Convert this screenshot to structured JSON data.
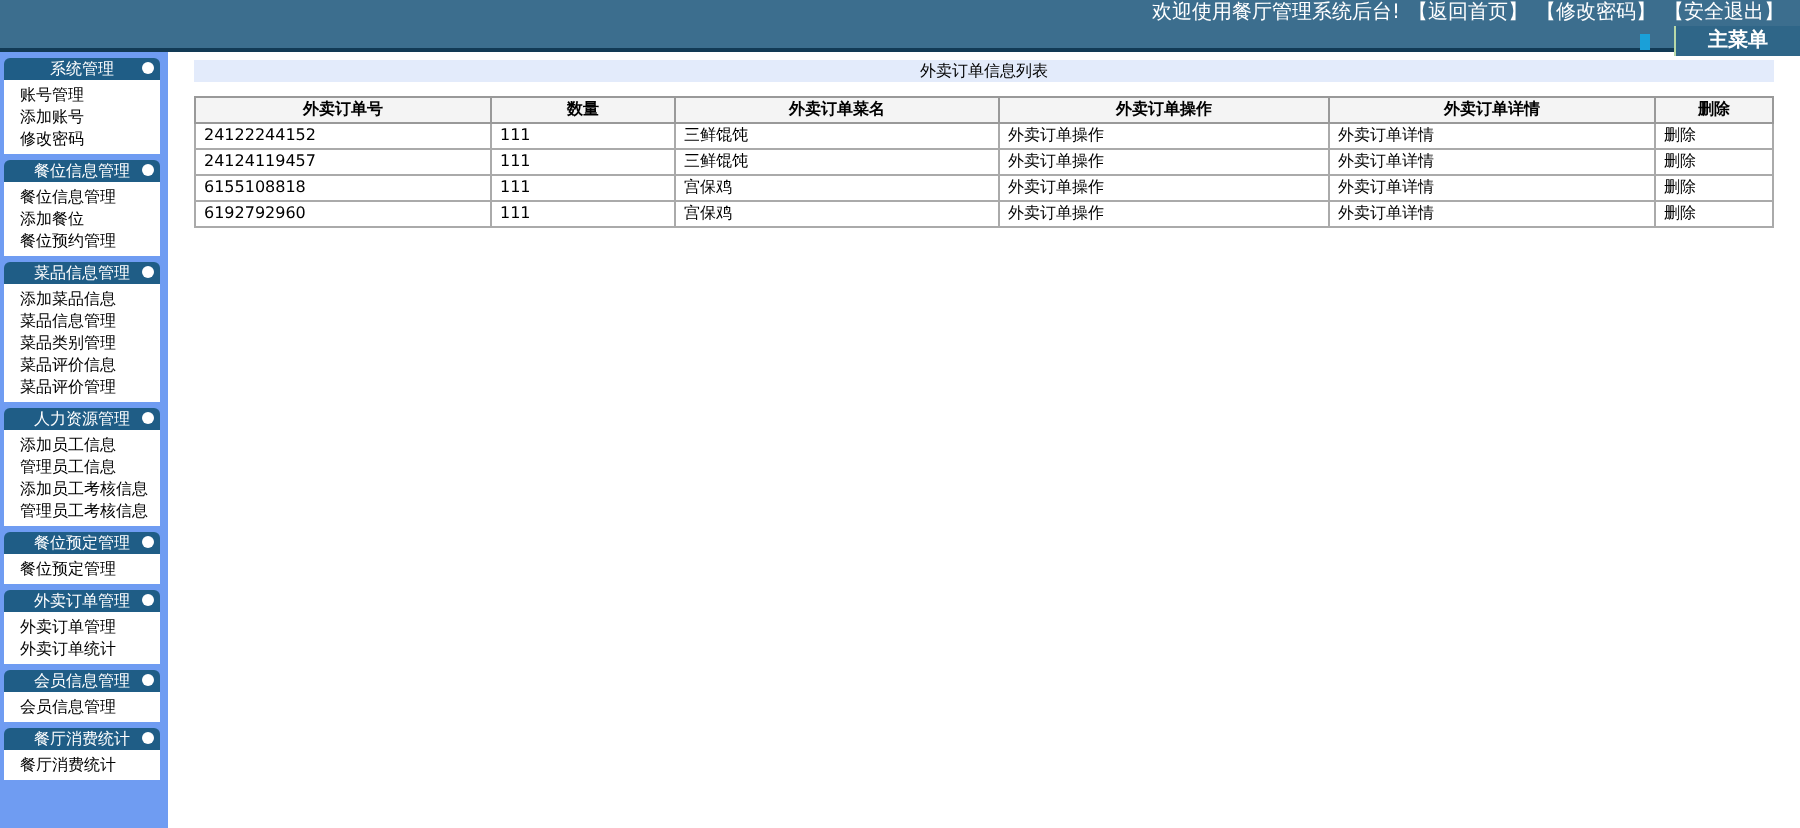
{
  "top_bar": {
    "welcome": "欢迎使用餐厅管理系统后台!",
    "links": [
      "【返回首页】",
      "【修改密码】",
      "【安全退出】"
    ]
  },
  "menu_button": "主菜单",
  "sidebar": [
    {
      "title": "系统管理",
      "items": [
        "账号管理",
        "添加账号",
        "修改密码"
      ]
    },
    {
      "title": "餐位信息管理",
      "items": [
        "餐位信息管理",
        "添加餐位",
        "餐位预约管理"
      ]
    },
    {
      "title": "菜品信息管理",
      "items": [
        "添加菜品信息",
        "菜品信息管理",
        "菜品类别管理",
        "菜品评价信息",
        "菜品评价管理"
      ]
    },
    {
      "title": "人力资源管理",
      "items": [
        "添加员工信息",
        "管理员工信息",
        "添加员工考核信息",
        "管理员工考核信息"
      ]
    },
    {
      "title": "餐位预定管理",
      "items": [
        "餐位预定管理"
      ]
    },
    {
      "title": "外卖订单管理",
      "items": [
        "外卖订单管理",
        "外卖订单统计"
      ]
    },
    {
      "title": "会员信息管理",
      "items": [
        "会员信息管理"
      ]
    },
    {
      "title": "餐厅消费统计",
      "items": [
        "餐厅消费统计"
      ]
    }
  ],
  "panel_title": "外卖订单信息列表",
  "table": {
    "columns": [
      "外卖订单号",
      "数量",
      "外卖订单菜名",
      "外卖订单操作",
      "外卖订单详情",
      "删除"
    ],
    "rows": [
      [
        "24122244152",
        "111",
        "三鲜馄饨",
        "外卖订单操作",
        "外卖订单详情",
        "删除"
      ],
      [
        "24124119457",
        "111",
        "三鲜馄饨",
        "外卖订单操作",
        "外卖订单详情",
        "删除"
      ],
      [
        "6155108818",
        "111",
        "宫保鸡",
        "外卖订单操作",
        "外卖订单详情",
        "删除"
      ],
      [
        "6192792960",
        "111",
        "宫保鸡",
        "外卖订单操作",
        "外卖订单详情",
        "删除"
      ]
    ]
  }
}
